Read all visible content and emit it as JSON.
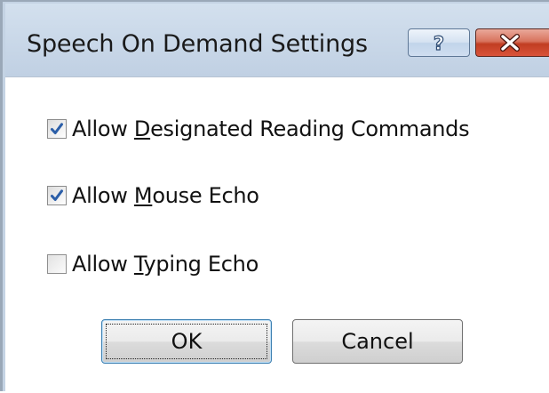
{
  "window": {
    "title": "Speech On Demand Settings",
    "help_glyph": "?",
    "help_icon": "question-icon",
    "close_icon": "close-icon",
    "close_color": "#c73e24"
  },
  "checkboxes": [
    {
      "prefix": "Allow ",
      "mnemonic": "D",
      "rest": "esignated Reading Commands",
      "checked": true
    },
    {
      "prefix": "Allow ",
      "mnemonic": "M",
      "rest": "ouse Echo",
      "checked": true
    },
    {
      "prefix": "Allow ",
      "mnemonic": "T",
      "rest": "yping Echo",
      "checked": false
    }
  ],
  "buttons": {
    "ok_label": "OK",
    "cancel_label": "Cancel"
  },
  "colors": {
    "title_bar": "#c8d7e8",
    "check_mark": "#2b5ea8"
  }
}
